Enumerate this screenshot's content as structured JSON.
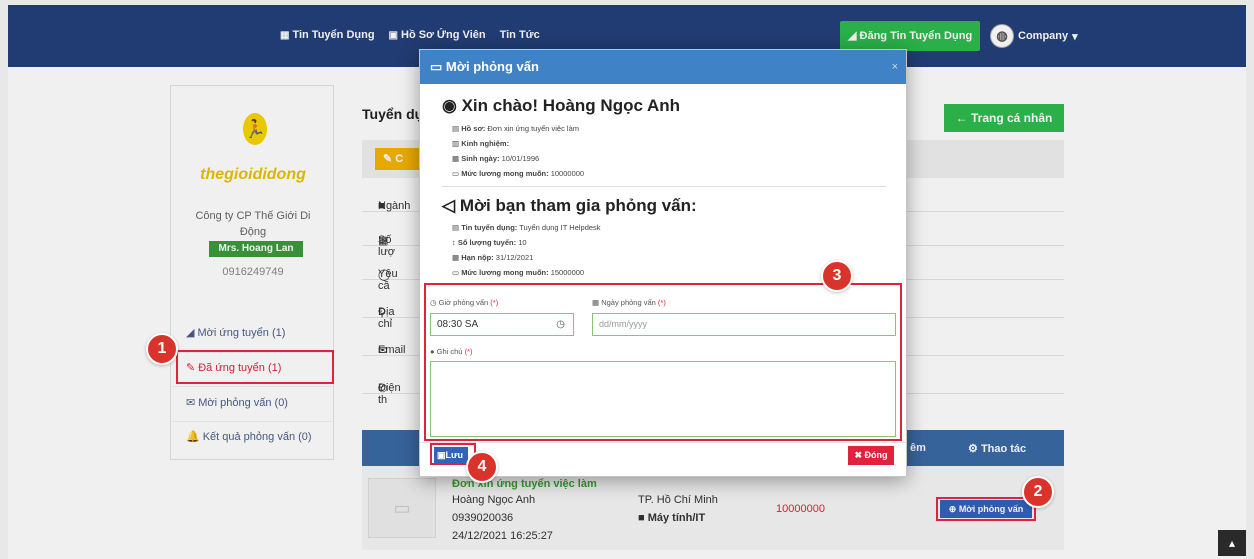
{
  "nav": {
    "links": [
      {
        "icon": "grid-icon",
        "glyph": "▦",
        "label": "Tin Tuyển Dụng"
      },
      {
        "icon": "profile-icon",
        "glyph": "▣",
        "label": "Hồ Sơ Ứng Viên"
      },
      {
        "icon": "",
        "glyph": "",
        "label": "Tin Tức"
      }
    ],
    "post_button": "Đăng Tin Tuyển Dụng",
    "account_label": "Company"
  },
  "sidebar": {
    "company_name": "Công ty CP Thế Giới Di Động",
    "logo_text": "thegioididong",
    "contact_name": "Mrs. Hoang Lan",
    "phone": "0916249749",
    "menu": [
      {
        "label": "Mời ứng tuyển (1)",
        "icon": "send-icon",
        "glyph": "◢",
        "active": false
      },
      {
        "label": "Đã ứng tuyển (1)",
        "icon": "edit-icon",
        "glyph": "✎",
        "active": true
      },
      {
        "label": "Mời phỏng vấn (0)",
        "icon": "envelope-icon",
        "glyph": "✉",
        "active": false
      },
      {
        "label": "Kết quả phỏng vấn (0)",
        "icon": "bell-icon",
        "glyph": "🔔",
        "active": false
      }
    ]
  },
  "main": {
    "title": "Tuyển dụ",
    "back_button": "Trang cá nhân",
    "edit_button": "C",
    "info_rows": [
      {
        "icon": "briefcase-icon",
        "glyph": "■",
        "label": "Ngành"
      },
      {
        "icon": "calendar-icon",
        "glyph": "▦",
        "label": "Số lượ"
      },
      {
        "icon": "chat-icon",
        "glyph": "◯",
        "label": "Yêu cầ"
      },
      {
        "icon": "location-icon",
        "glyph": "⚲",
        "label": "Địa chỉ"
      },
      {
        "icon": "envelope-icon",
        "glyph": "✉",
        "label": "Email"
      },
      {
        "icon": "phone-icon",
        "glyph": "✆",
        "label": "Điện th"
      }
    ],
    "table": {
      "header_experience": "êm",
      "header_actions": "Thao tác",
      "row": {
        "title": "Đơn xin ứng tuyển việc làm",
        "name": "Hoàng Ngọc Anh",
        "phone": "0939020036",
        "date": "24/12/2021 16:25:27",
        "city": "TP. Hồ Chí Minh",
        "field": "Máy tính/IT",
        "salary": "10000000",
        "action": "Mời phỏng vấn"
      }
    }
  },
  "modal": {
    "title": "Mời phỏng vấn",
    "greeting": "Xin chào! Hoàng Ngọc Anh",
    "candidate": [
      {
        "label": "Hồ sơ:",
        "value": "Đơn xin ứng tuyển việc làm"
      },
      {
        "label": "Kinh nghiệm:",
        "value": ""
      },
      {
        "label": "Sinh ngày:",
        "value": "10/01/1996"
      },
      {
        "label": "Mức lương mong muốn:",
        "value": "10000000"
      }
    ],
    "invite_heading": "Mời bạn tham gia phỏng vấn:",
    "job": [
      {
        "label": "Tin tuyển dụng:",
        "value": "Tuyển dụng IT Helpdesk"
      },
      {
        "label": "Số lượng tuyển:",
        "value": "10"
      },
      {
        "label": "Hạn nộp:",
        "value": "31/12/2021"
      },
      {
        "label": "Mức lương mong muốn:",
        "value": "15000000"
      }
    ],
    "time_label": "Giờ phỏng vấn",
    "time_value": "08:30 SA",
    "date_label": "Ngày phỏng vấn",
    "date_placeholder": "dd/mm/yyyy",
    "note_label": "Ghi chú",
    "required_mark": "(*)",
    "save_button": "Lưu",
    "close_button": "Đóng"
  },
  "annotations": {
    "steps": [
      "1",
      "2",
      "3",
      "4"
    ],
    "color": "#e0233c"
  },
  "colors": {
    "navbar": "#24407a",
    "modal_header": "#3f82c6",
    "success": "#2dba4e",
    "danger": "#e0233c",
    "primary": "#2f64b8"
  }
}
